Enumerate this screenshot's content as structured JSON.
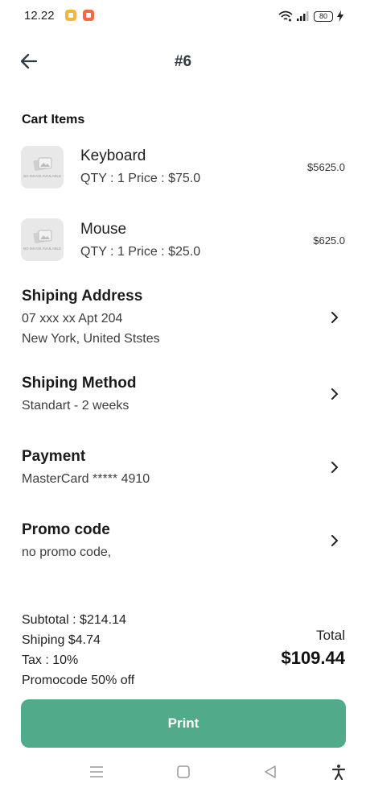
{
  "status_bar": {
    "time": "12.22",
    "battery": "80",
    "icons": [
      "wifi-icon",
      "signal-icon",
      "battery-icon",
      "charging-icon"
    ]
  },
  "app_bar": {
    "title": "#6",
    "back_icon": "arrow-left-icon"
  },
  "cart": {
    "heading": "Cart Items",
    "thumb_text": "NO IMAGE AVAILABLE",
    "items": [
      {
        "name": "Keyboard",
        "detail": "QTY : 1  Price : $75.0",
        "total": "$5625.0"
      },
      {
        "name": "Mouse",
        "detail": "QTY : 1  Price : $25.0",
        "total": "$625.0"
      }
    ]
  },
  "shipping_address": {
    "title": "Shiping Address",
    "line1": "07 xxx xx Apt 204",
    "line2": "New York, United Ststes"
  },
  "shipping_method": {
    "title": "Shiping Method",
    "value": "Standart - 2 weeks"
  },
  "payment": {
    "title": "Payment",
    "value": "MasterCard ***** 4910"
  },
  "promo": {
    "title": "Promo code",
    "value": "no promo code,"
  },
  "summary": {
    "subtotal": "Subtotal : $214.14",
    "shipping": "Shiping $4.74",
    "tax": "Tax : 10%",
    "promocode": "Promocode 50% off",
    "total_label": "Total",
    "total_value": "$109.44"
  },
  "print_button": {
    "label": "Print"
  },
  "nav_bar": {
    "icons": [
      "menu-icon",
      "home-square-icon",
      "back-triangle-icon",
      "accessibility-icon"
    ]
  },
  "colors": {
    "accent": "#51ab8a",
    "status_icon_1": "#f4b63a",
    "status_icon_2": "#f26a43"
  }
}
